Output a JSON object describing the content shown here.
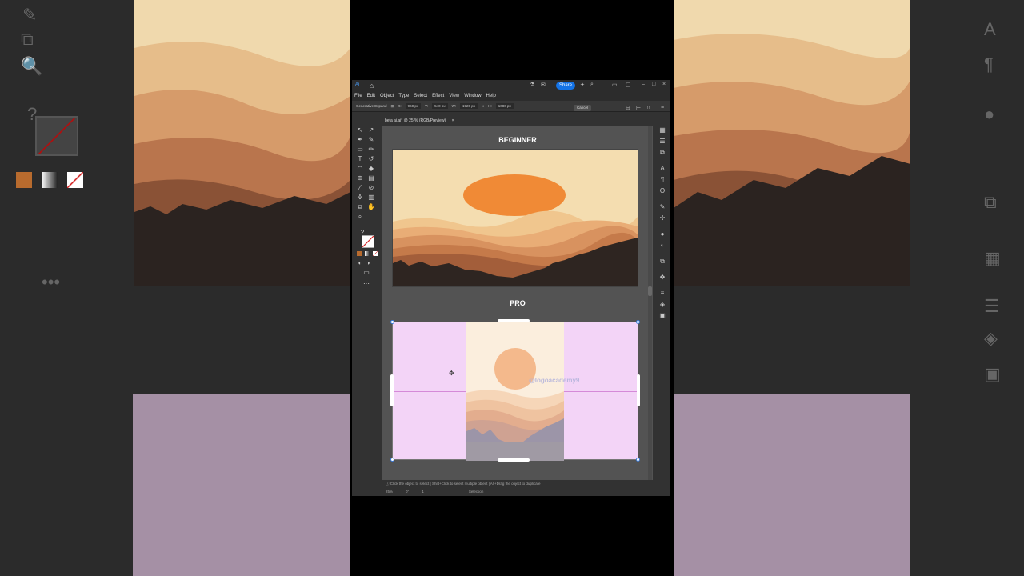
{
  "app": {
    "doc_tab": "beta ai.ai* @ 25 % (RGB/Preview)",
    "share_label": "Share",
    "menu": [
      "File",
      "Edit",
      "Object",
      "Type",
      "Select",
      "Effect",
      "View",
      "Window",
      "Help"
    ],
    "control": {
      "generative_expand": "Generative Expand",
      "x_label": "X:",
      "x_value": "960 px",
      "y_label": "Y:",
      "y_value": "540 px",
      "w_label": "W:",
      "w_value": "1920 px",
      "h_label": "H:",
      "h_value": "1080 px",
      "cancel_label": "Cancel"
    }
  },
  "canvas": {
    "beginner_label": "BEGINNER",
    "pro_label": "PRO",
    "watermark": "@logoacademy9"
  },
  "status": {
    "hint": "Click the object to select  |  Shift+Click to select multiple object  |  Alt+Drag the object to duplicate",
    "zoom": "25%",
    "rotation": "0°",
    "artboard": "1",
    "mode": "Selection"
  },
  "colors": {
    "sun_beginner": "#f08a36",
    "sun_pro": "#f4b98c",
    "expand_fill": "#f3d4f7",
    "selection": "#3b7ee0",
    "share_blue": "#1473e6"
  }
}
